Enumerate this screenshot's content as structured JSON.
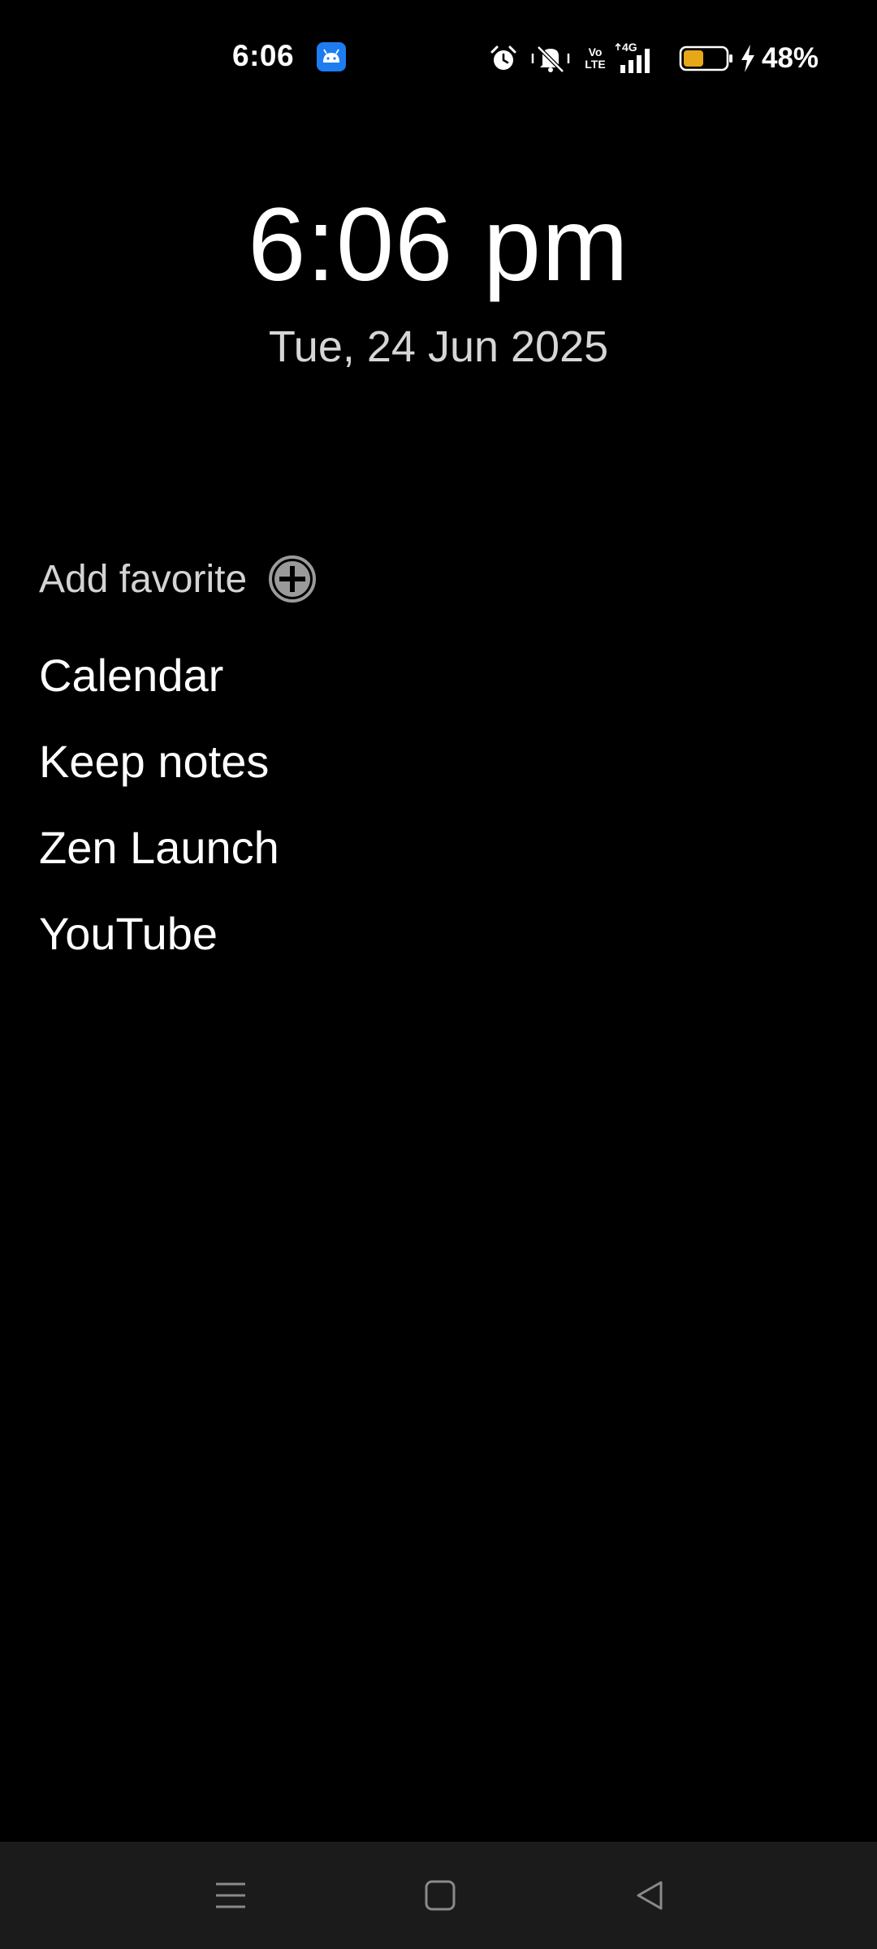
{
  "status_bar": {
    "time": "6:06",
    "notification_icon": "android-app-icon",
    "icons": [
      "alarm-icon",
      "silent-bell-icon",
      "volte-icon",
      "4g-signal-icon",
      "battery-icon",
      "charging-bolt-icon"
    ],
    "volte_text": "Vo LTE",
    "network_text": "4G",
    "battery_percent": "48%",
    "battery_level": 0.48,
    "battery_color": "#e6a817"
  },
  "clock": {
    "time": "6:06 pm",
    "date": "Tue, 24 Jun 2025"
  },
  "favorites": {
    "add_label": "Add favorite",
    "add_icon": "plus-circle-icon",
    "items": [
      {
        "label": "Calendar"
      },
      {
        "label": "Keep notes"
      },
      {
        "label": "Zen Launch"
      },
      {
        "label": "YouTube"
      }
    ]
  },
  "nav_bar": {
    "buttons": [
      "menu-icon",
      "home-icon",
      "back-icon"
    ]
  }
}
